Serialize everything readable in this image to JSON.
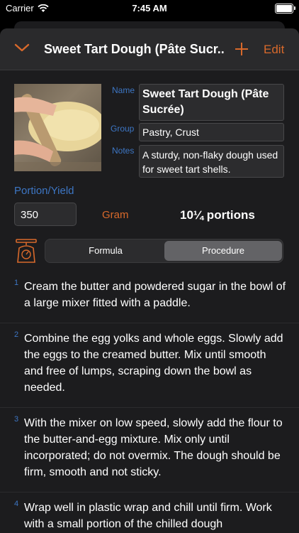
{
  "status": {
    "carrier": "Carrier",
    "time": "7:45 AM"
  },
  "nav": {
    "title": "Sweet Tart Dough (Pâte Sucr...",
    "edit_label": "Edit"
  },
  "recipe": {
    "name_label": "Name",
    "name": "Sweet Tart Dough (Pâte Sucrée)",
    "group_label": "Group",
    "group": "Pastry, Crust",
    "notes_label": "Notes",
    "notes": "A sturdy, non-flaky dough used for sweet tart shells."
  },
  "portion": {
    "label": "Portion/Yield",
    "value": "350",
    "unit": "Gram",
    "portions": "10¼ portions"
  },
  "segments": {
    "formula": "Formula",
    "procedure": "Procedure",
    "selected": "Procedure"
  },
  "steps": [
    {
      "num": "1",
      "text": "Cream the butter and powdered sugar in the bowl of a large mixer fitted with a paddle."
    },
    {
      "num": "2",
      "text": "Combine the egg yolks and whole eggs. Slowly add the eggs to the creamed butter. Mix until smooth and free of lumps, scraping down the bowl as needed."
    },
    {
      "num": "3",
      "text": "With the mixer on low speed, slowly add the flour to the butter-and-egg mixture. Mix only until incorporated; do not overmix. The dough should be firm, smooth and not sticky."
    },
    {
      "num": "4",
      "text": "Wrap well in plastic wrap and chill until firm. Work with a small portion of the chilled dough"
    }
  ],
  "colors": {
    "accent": "#d8692b",
    "label_blue": "#3d76c4",
    "background": "#1c1c1e"
  },
  "icons": [
    "wifi-icon",
    "battery-icon",
    "chevron-down-icon",
    "plus-icon",
    "kitchen-scale-icon"
  ]
}
